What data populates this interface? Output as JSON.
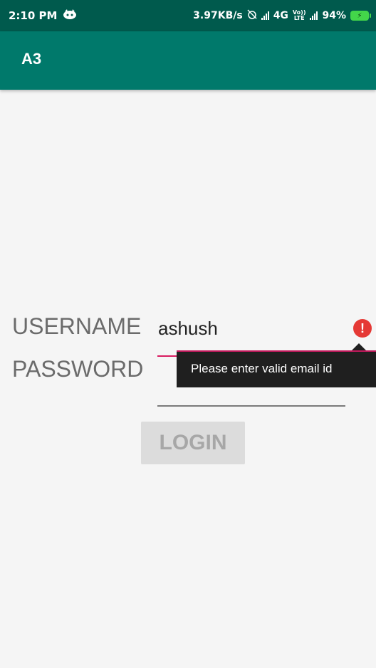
{
  "status_bar": {
    "time": "2:10 PM",
    "network_speed": "3.97KB/s",
    "network_type": "4G",
    "volte_top": "Vo))",
    "volte_bottom": "LTE",
    "battery": "94%",
    "icons": [
      "notification-face-icon",
      "alarm-off-icon",
      "signal-icon",
      "volte-icon",
      "battery-charging-icon"
    ]
  },
  "app_bar": {
    "title": "A3"
  },
  "form": {
    "username_label": "USERNAME",
    "username_value": "ashush",
    "password_label": "PASSWORD",
    "password_value": "",
    "error_icon": "!",
    "error_message": "Please enter valid email id",
    "login_label": "LOGIN"
  },
  "colors": {
    "status_bar": "#005a4d",
    "app_bar": "#00796b",
    "error": "#e53935",
    "error_underline": "#d81b60",
    "popup": "#1f1f1f"
  }
}
